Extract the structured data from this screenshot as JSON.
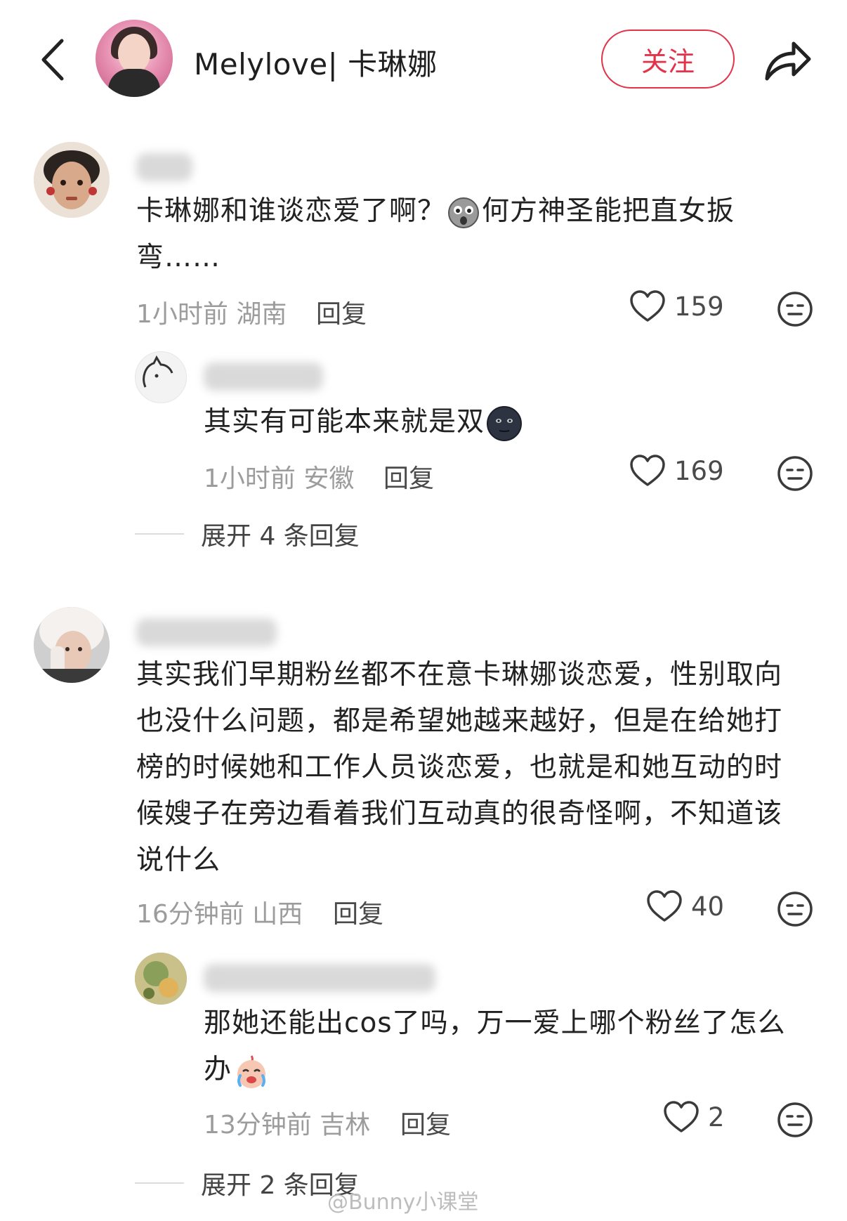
{
  "header": {
    "author_name": "Melylove| 卡琳娜",
    "follow_label": "关注",
    "icons": {
      "back": "chevron-left-icon",
      "share": "share-arrow-icon",
      "like": "heart-outline-icon",
      "reaction": "neutral-face-icon"
    },
    "accent_color": "#e3334a"
  },
  "comments": [
    {
      "text_part1": "卡琳娜和谁谈恋爱了啊？",
      "text_part2": "何方神圣能把直女扳弯……",
      "emoji": "shocked-face-emoji",
      "time": "1小时前 湖南",
      "reply_label": "回复",
      "likes": "159",
      "replies": [
        {
          "text": "其实有可能本来就是双",
          "emoji": "new-moon-face-emoji",
          "time": "1小时前 安徽",
          "reply_label": "回复",
          "likes": "169"
        }
      ],
      "expand_label": "展开 4 条回复"
    },
    {
      "text_line1": "其实我们早期粉丝都不在意卡琳娜谈恋爱，性别取向",
      "text_line2": "也没什么问题，都是希望她越来越好，但是在给她打",
      "text_line3": "榜的时候她和工作人员谈恋爱，也就是和她互动的时",
      "text_line4": "候嫂子在旁边看着我们互动真的很奇怪啊，不知道该",
      "text_line5": "说什么",
      "time": "16分钟前 山西",
      "reply_label": "回复",
      "likes": "40",
      "replies": [
        {
          "text_line1": "那她还能出cos了吗，万一爱上哪个粉丝了怎么",
          "text_line2": "办",
          "emoji": "crying-face-emoji",
          "time": "13分钟前 吉林",
          "reply_label": "回复",
          "likes": "2"
        }
      ],
      "expand_label": "展开 2 条回复"
    }
  ],
  "watermark": "@Bunny小课堂"
}
